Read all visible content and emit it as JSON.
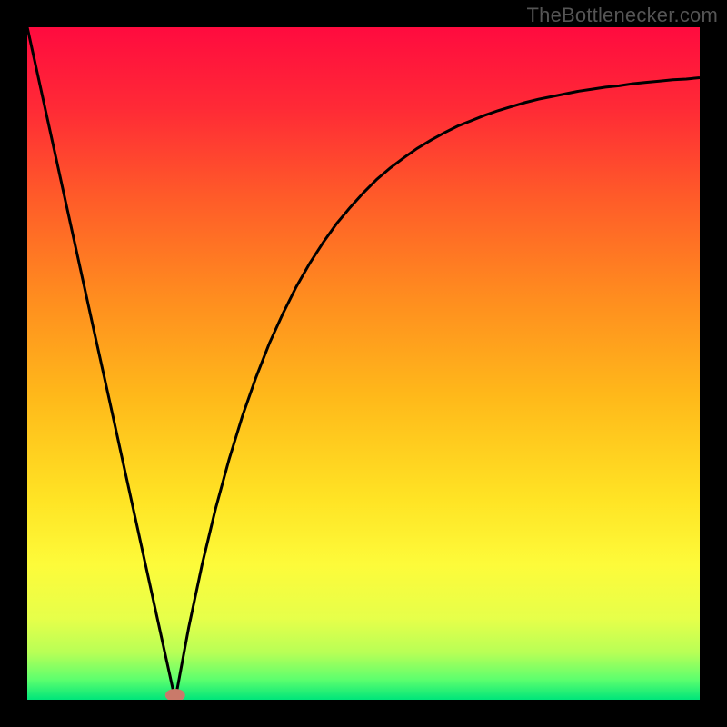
{
  "watermark": "TheBottlenecker.com",
  "chart_data": {
    "type": "line",
    "title": "",
    "xlabel": "",
    "ylabel": "",
    "xlim": [
      0,
      100
    ],
    "ylim": [
      0,
      100
    ],
    "x_min_point": 22,
    "series": [
      {
        "name": "curve",
        "x": [
          0,
          2,
          4,
          6,
          8,
          10,
          12,
          14,
          16,
          18,
          20,
          22,
          24,
          26,
          28,
          30,
          32,
          34,
          36,
          38,
          40,
          42,
          44,
          46,
          48,
          50,
          52,
          54,
          56,
          58,
          60,
          62,
          64,
          66,
          68,
          70,
          72,
          74,
          76,
          78,
          80,
          82,
          84,
          86,
          88,
          90,
          92,
          94,
          96,
          98,
          100
        ],
        "y": [
          100,
          90.9,
          81.8,
          72.7,
          63.6,
          54.5,
          45.5,
          36.4,
          27.3,
          18.2,
          9.1,
          0,
          10.7,
          20.1,
          28.4,
          35.7,
          42.2,
          47.9,
          53.0,
          57.4,
          61.4,
          64.9,
          68.0,
          70.8,
          73.2,
          75.4,
          77.4,
          79.1,
          80.6,
          82.0,
          83.2,
          84.3,
          85.3,
          86.1,
          86.9,
          87.6,
          88.2,
          88.8,
          89.3,
          89.7,
          90.1,
          90.5,
          90.8,
          91.1,
          91.3,
          91.6,
          91.8,
          92.0,
          92.2,
          92.3,
          92.5
        ]
      }
    ],
    "marker": {
      "x": 22,
      "y": 0,
      "color": "#c97a6a"
    },
    "background_gradient": {
      "stops": [
        {
          "offset": 0.0,
          "color": "#ff0b3f"
        },
        {
          "offset": 0.12,
          "color": "#ff2a36"
        },
        {
          "offset": 0.25,
          "color": "#ff5a29"
        },
        {
          "offset": 0.4,
          "color": "#ff8c1f"
        },
        {
          "offset": 0.55,
          "color": "#ffb91a"
        },
        {
          "offset": 0.7,
          "color": "#ffe324"
        },
        {
          "offset": 0.8,
          "color": "#fdfb3a"
        },
        {
          "offset": 0.88,
          "color": "#e6ff4a"
        },
        {
          "offset": 0.93,
          "color": "#b8ff56"
        },
        {
          "offset": 0.97,
          "color": "#5dff6e"
        },
        {
          "offset": 1.0,
          "color": "#00e57a"
        }
      ]
    }
  }
}
